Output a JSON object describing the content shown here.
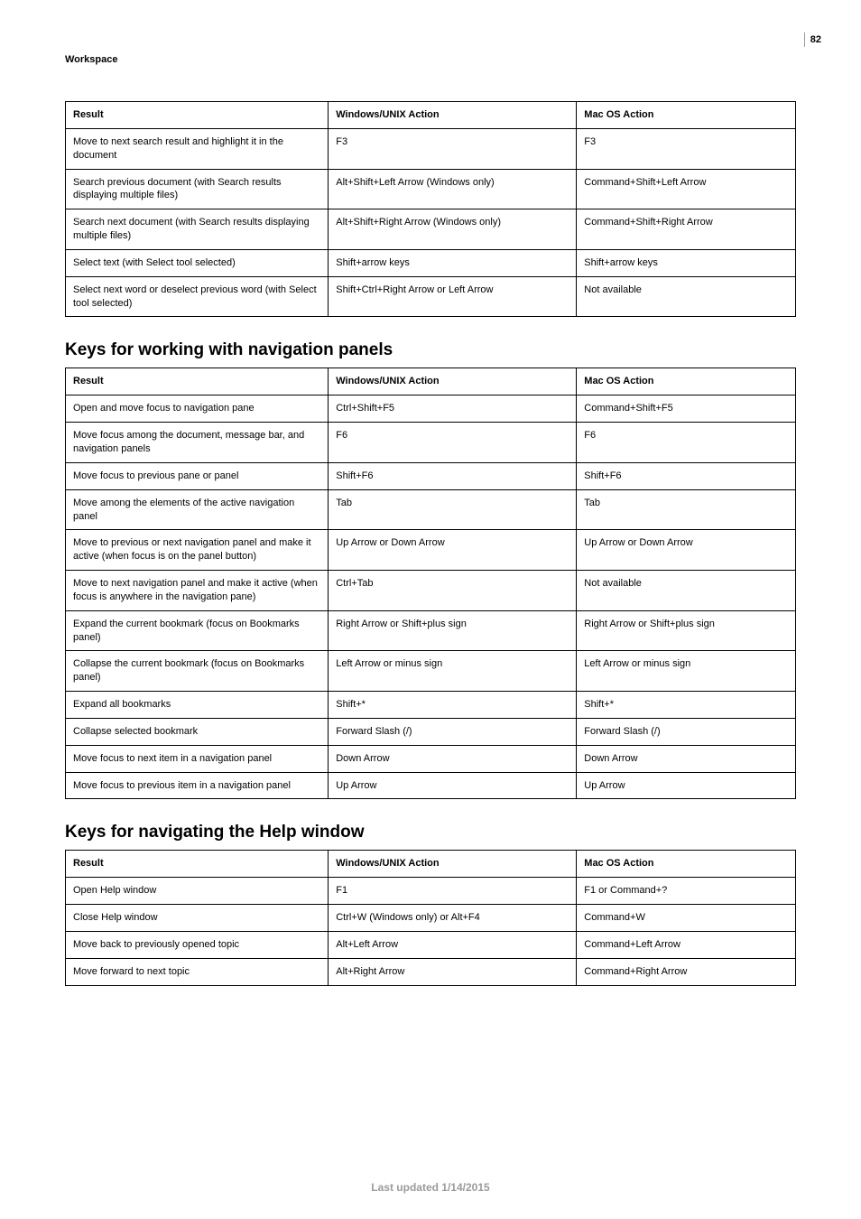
{
  "page": {
    "breadcrumb": "Workspace",
    "number": "82",
    "footer": "Last updated 1/14/2015"
  },
  "sections": [
    {
      "title": "",
      "headers": [
        "Result",
        "Windows/UNIX Action",
        "Mac OS Action"
      ],
      "rows": [
        [
          "Move to next search result and highlight it in the document",
          "F3",
          "F3"
        ],
        [
          "Search previous document (with Search results displaying multiple files)",
          "Alt+Shift+Left Arrow (Windows only)",
          "Command+Shift+Left Arrow"
        ],
        [
          "Search next document (with Search results displaying multiple files)",
          "Alt+Shift+Right Arrow (Windows only)",
          "Command+Shift+Right Arrow"
        ],
        [
          "Select text (with Select tool selected)",
          "Shift+arrow keys",
          "Shift+arrow keys"
        ],
        [
          "Select next word or deselect previous word (with Select tool selected)",
          "Shift+Ctrl+Right Arrow or Left Arrow",
          "Not available"
        ]
      ]
    },
    {
      "title": "Keys for working with navigation panels",
      "headers": [
        "Result",
        "Windows/UNIX Action",
        "Mac OS Action"
      ],
      "rows": [
        [
          "Open and move focus to navigation pane",
          "Ctrl+Shift+F5",
          "Command+Shift+F5"
        ],
        [
          "Move focus among the document, message bar, and navigation panels",
          "F6",
          "F6"
        ],
        [
          "Move focus to previous pane or panel",
          "Shift+F6",
          "Shift+F6"
        ],
        [
          "Move among the elements of the active navigation panel",
          "Tab",
          "Tab"
        ],
        [
          "Move to previous or next navigation panel and make it active (when focus is on the panel button)",
          "Up Arrow or Down Arrow",
          "Up Arrow or Down Arrow"
        ],
        [
          "Move to next navigation panel and make it active (when focus is anywhere in the navigation pane)",
          "Ctrl+Tab",
          "Not available"
        ],
        [
          "Expand the current bookmark (focus on Bookmarks panel)",
          "Right Arrow or Shift+plus sign",
          "Right Arrow or Shift+plus sign"
        ],
        [
          "Collapse the current bookmark (focus on Bookmarks panel)",
          "Left Arrow or minus sign",
          "Left Arrow or minus sign"
        ],
        [
          "Expand all bookmarks",
          "Shift+*",
          "Shift+*"
        ],
        [
          "Collapse selected bookmark",
          "Forward Slash (/)",
          "Forward Slash (/)"
        ],
        [
          "Move focus to next item in a navigation panel",
          "Down Arrow",
          "Down Arrow"
        ],
        [
          "Move focus to previous item in a navigation panel",
          "Up Arrow",
          "Up Arrow"
        ]
      ]
    },
    {
      "title": "Keys for navigating the Help window",
      "headers": [
        "Result",
        "Windows/UNIX Action",
        "Mac OS Action"
      ],
      "rows": [
        [
          "Open Help window",
          "F1",
          "F1 or Command+?"
        ],
        [
          "Close Help window",
          "Ctrl+W (Windows only) or Alt+F4",
          "Command+W"
        ],
        [
          "Move back to previously opened topic",
          "Alt+Left Arrow",
          "Command+Left Arrow"
        ],
        [
          "Move forward to next topic",
          "Alt+Right Arrow",
          "Command+Right Arrow"
        ]
      ]
    }
  ]
}
